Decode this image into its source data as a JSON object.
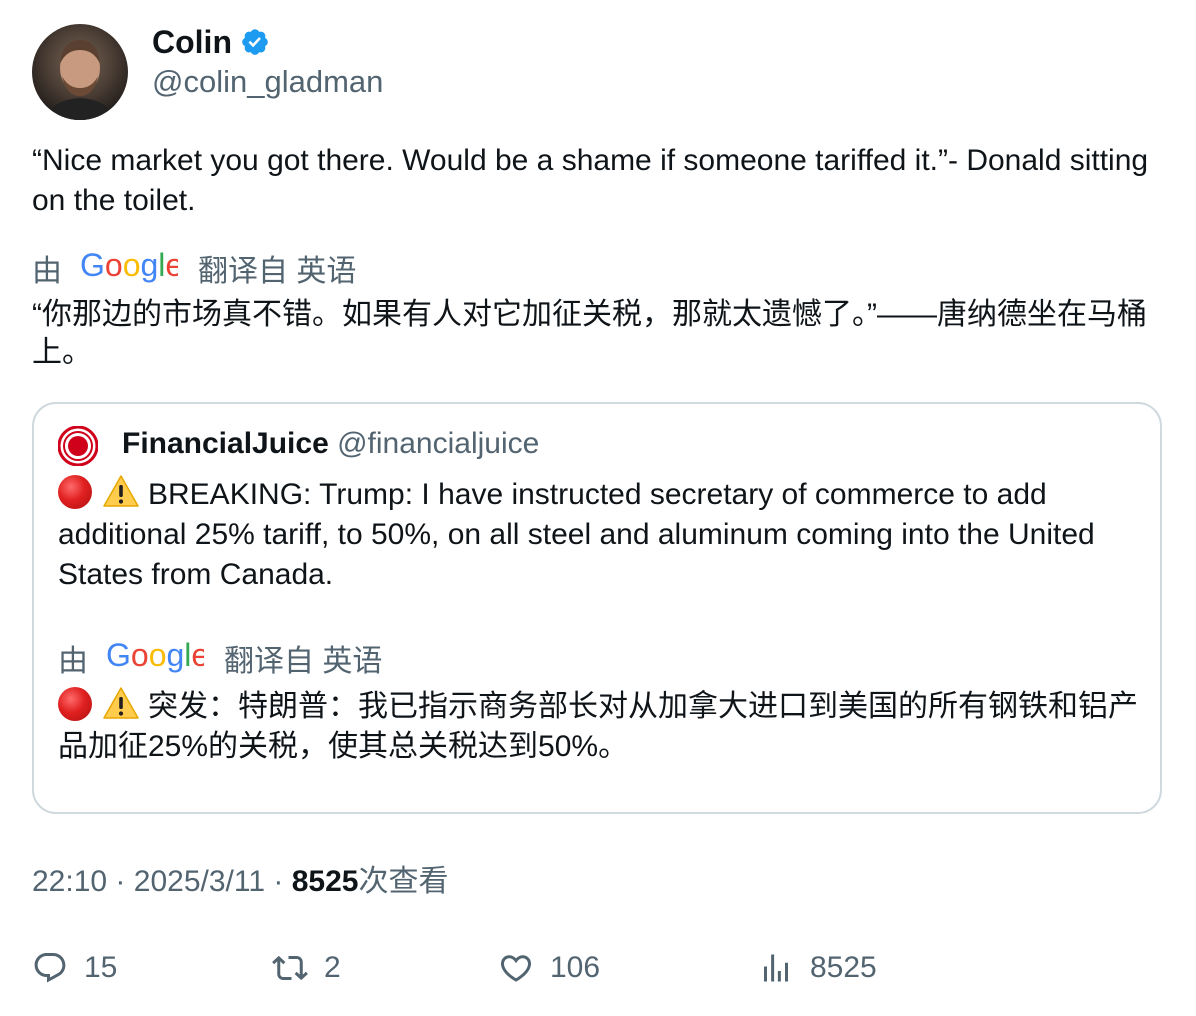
{
  "author": {
    "name": "Colin",
    "handle": "@colin_gladman",
    "verified": true
  },
  "tweet": {
    "text": "“Nice market you got there.  Would be a shame if someone tariffed it.”- Donald sitting on the toilet.",
    "translation_by": "由",
    "translation_provider": "Google",
    "translation_from": "翻译自 英语",
    "translated_text": "“你那边的市场真不错。如果有人对它加征关税，那就太遗憾了。”——唐纳德坐在马桶上。"
  },
  "quote": {
    "name": "FinancialJuice",
    "handle": "@financialjuice",
    "text": "BREAKING: Trump: I have instructed secretary of commerce to add additional 25% tariff, to 50%, on all steel and aluminum coming into the United States from Canada.",
    "translation_by": "由",
    "translation_provider": "Google",
    "translation_from": "翻译自 英语",
    "translated_text": "突发：特朗普：我已指示商务部长对从加拿大进口到美国的所有钢铁和铝产品加征25%的关税，使其总关税达到50%。"
  },
  "meta": {
    "time": "22:10",
    "separator": "·",
    "date": "2025/3/11",
    "views_count": "8525",
    "views_label": "次查看"
  },
  "actions": {
    "replies": "15",
    "retweets": "2",
    "likes": "106",
    "views": "8525"
  },
  "colors": {
    "verified_blue": "#1d9bf0",
    "secondary_text": "#536471",
    "border": "#cfd9de"
  }
}
